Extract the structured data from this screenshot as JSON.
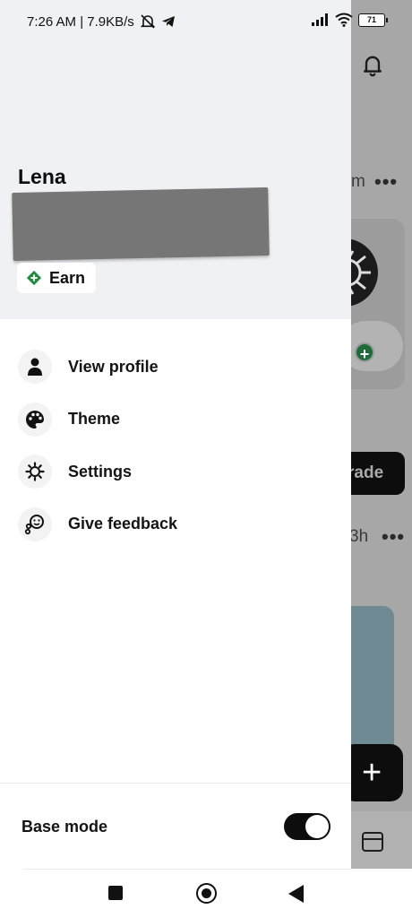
{
  "status_bar": {
    "time_speed": "7:26 AM | 7.9KB/s",
    "battery": "71"
  },
  "background": {
    "time_1": "m",
    "time_2": "3h",
    "trade_label": "rade",
    "more_dots": "•••",
    "fab_plus": "+"
  },
  "drawer": {
    "user_name": "Lena",
    "earn_label": "Earn",
    "earn_icon_color": "#1e8e3e",
    "menu": [
      {
        "label": "View profile",
        "icon": "person-icon"
      },
      {
        "label": "Theme",
        "icon": "palette-icon"
      },
      {
        "label": "Settings",
        "icon": "gear-icon"
      },
      {
        "label": "Give feedback",
        "icon": "feedback-icon"
      }
    ],
    "base_mode_label": "Base mode",
    "base_mode_on": true
  }
}
